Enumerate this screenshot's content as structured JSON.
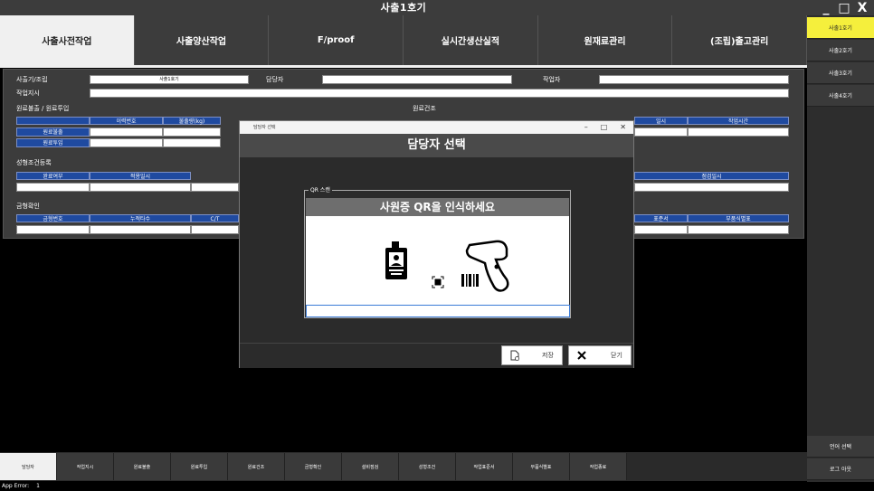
{
  "window": {
    "title": "사출1호기",
    "controls": [
      "_",
      "□",
      "X"
    ]
  },
  "tabs": [
    {
      "label": "사출사전작업",
      "active": true
    },
    {
      "label": "사출양산작업",
      "active": false
    },
    {
      "label": "F/proof",
      "active": false
    },
    {
      "label": "실시간생산실적",
      "active": false
    },
    {
      "label": "원재료관리",
      "active": false
    },
    {
      "label": "(조립)출고관리",
      "active": false
    }
  ],
  "sidebar": {
    "machines": [
      "사출1호기",
      "사출2호기",
      "사출3호기",
      "사출4호기"
    ],
    "language": "언어 선택",
    "logout": "로그 아웃"
  },
  "form": {
    "machine_label": "사출기/조립",
    "machine_value": "사출1호기",
    "manager_label": "담당자",
    "worker_label": "작업자",
    "instruction_label": "작업지시",
    "material_section": "원료불출 / 원료투입",
    "material_headers": [
      "이력번호",
      "불출량(kg)"
    ],
    "material_rows": [
      "원료불출",
      "원료투입"
    ],
    "drying_section": "원료건조",
    "drying_headers": [
      "일시",
      "작업시간"
    ],
    "molding_section": "성형조건등록",
    "molding_headers": [
      "완료여부",
      "적용일시"
    ],
    "inspect_header": "점검일시",
    "mold_section": "금형확인",
    "mold_headers": [
      "금형번호",
      "누적타수",
      "C/T"
    ],
    "mold_right_headers": [
      "표준서",
      "부품식별표"
    ]
  },
  "dialog": {
    "window_title": "담당자 선택",
    "controls": [
      "–",
      "□",
      "✕"
    ],
    "header": "담당자 선택",
    "group_legend": "QR 스캔",
    "qr_prompt": "사원증 QR을 인식하세요",
    "qr_input_value": "",
    "save_label": "저장",
    "close_label": "닫기"
  },
  "bottom_bar": [
    {
      "label": "담당자",
      "active": true
    },
    {
      "label": "작업지시",
      "active": false
    },
    {
      "label": "원료불출",
      "active": false
    },
    {
      "label": "원료투입",
      "active": false
    },
    {
      "label": "원료건조",
      "active": false
    },
    {
      "label": "금형확인",
      "active": false
    },
    {
      "label": "설비점검",
      "active": false
    },
    {
      "label": "성형조건",
      "active": false
    },
    {
      "label": "작업표준서",
      "active": false
    },
    {
      "label": "부품식별표",
      "active": false
    },
    {
      "label": "작업종료",
      "active": false
    }
  ],
  "status": {
    "label": "App Error:",
    "value": "1"
  }
}
